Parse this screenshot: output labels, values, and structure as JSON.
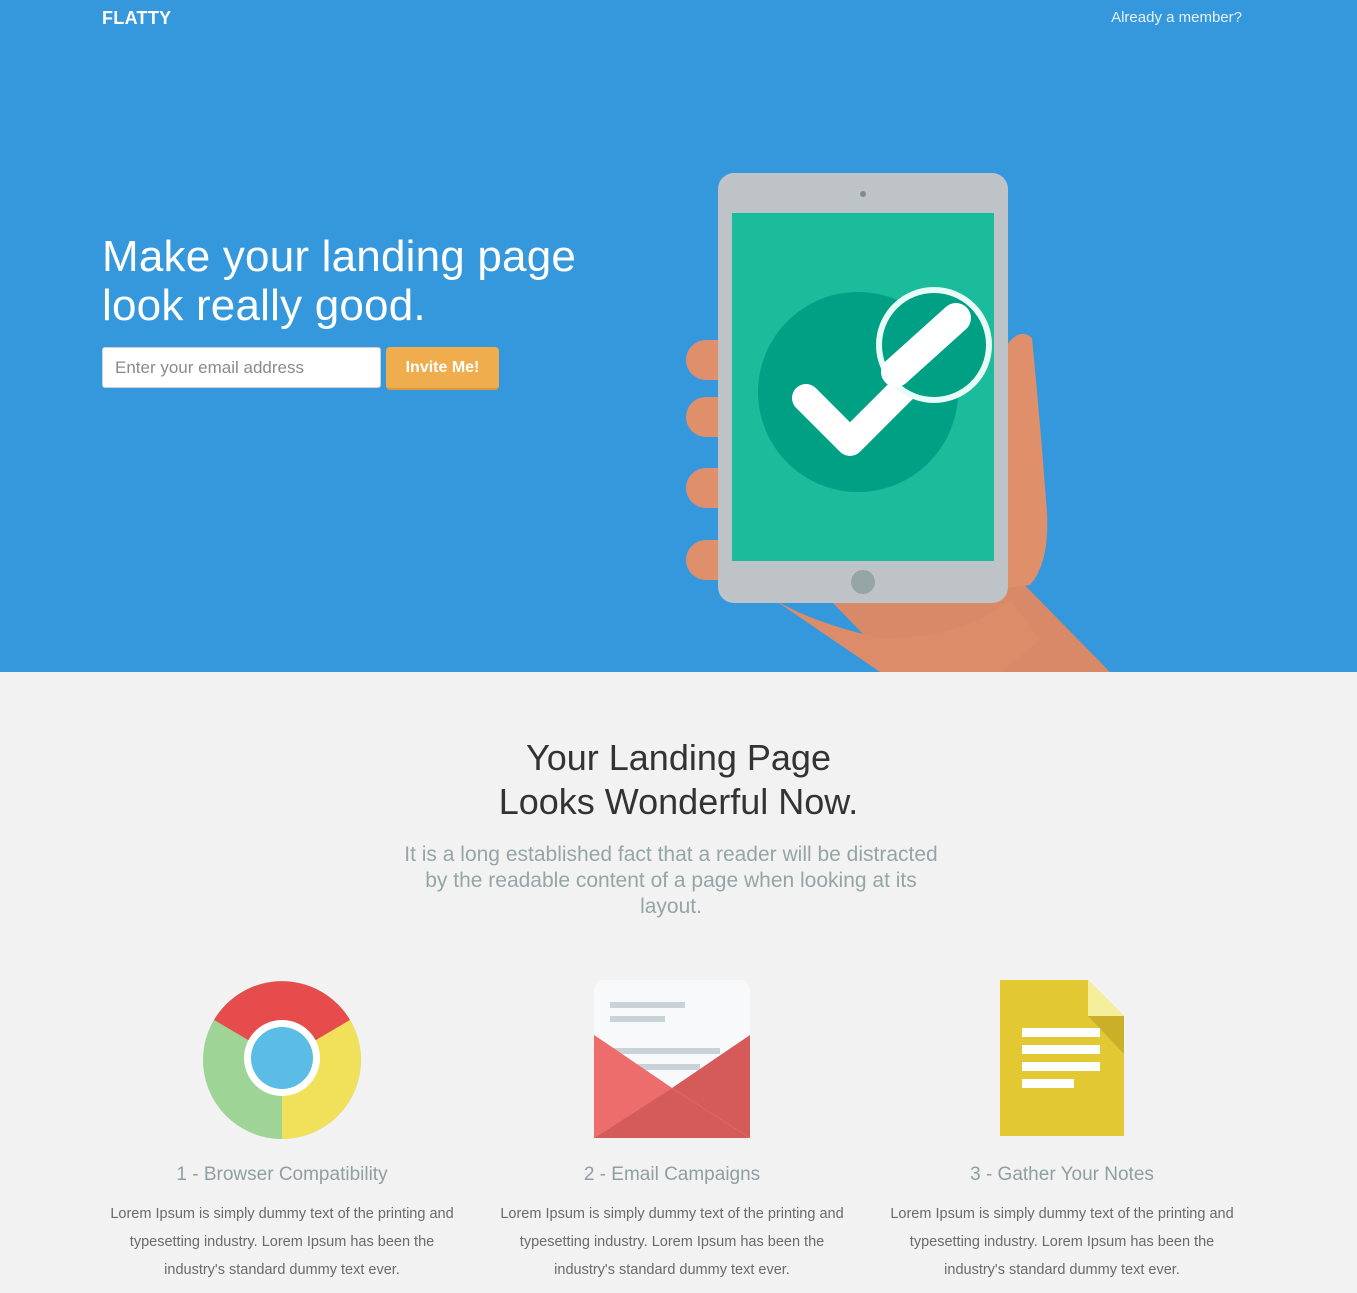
{
  "header": {
    "brand": "FLATTY",
    "member_link": "Already a member?"
  },
  "hero": {
    "headline": "Make your landing page look really good.",
    "email_placeholder": "Enter your email address",
    "invite_label": "Invite Me!",
    "illustration_icon": "hand-holding-tablet-checkmark"
  },
  "section": {
    "title_line1": "Your Landing Page",
    "title_line2": "Looks Wonderful Now.",
    "subtitle": "It is a long established fact that a reader will be distracted by the readable content of a page when looking at its layout."
  },
  "features": [
    {
      "icon": "chrome-browser-icon",
      "title": "1 - Browser Compatibility",
      "text": "Lorem Ipsum is simply dummy text of the printing and typesetting industry. Lorem Ipsum has been the industry's standard dummy text ever."
    },
    {
      "icon": "envelope-icon",
      "title": "2 - Email Campaigns",
      "text": "Lorem Ipsum is simply dummy text of the printing and typesetting industry. Lorem Ipsum has been the industry's standard dummy text ever."
    },
    {
      "icon": "document-notes-icon",
      "title": "3 - Gather Your Notes",
      "text": "Lorem Ipsum is simply dummy text of the printing and typesetting industry. Lorem Ipsum has been the industry's standard dummy text ever."
    }
  ],
  "colors": {
    "hero_bg": "#3598dc",
    "accent_button": "#f0ad4e",
    "page_bg": "#f2f2f2",
    "tablet_screen": "#1abc9c"
  }
}
